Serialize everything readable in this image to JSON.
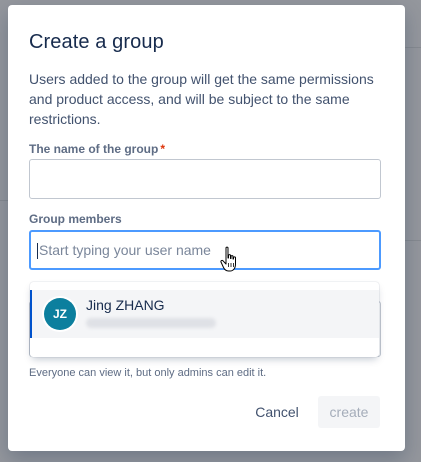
{
  "modal": {
    "title": "Create a group",
    "description": "Users added to the group will get the same permissions and product access, and will be subject to the same restrictions.",
    "group_name": {
      "label": "The name of the group",
      "required_marker": "*",
      "value": ""
    },
    "members": {
      "label": "Group members",
      "placeholder": "Start typing your user name",
      "value": ""
    },
    "visibility_hint": "Everyone can view it, but only admins can edit it.",
    "actions": {
      "cancel": "Cancel",
      "create": "create"
    }
  },
  "suggestions": [
    {
      "initials": "JZ",
      "name": "Jing ZHANG",
      "avatar_color": "#0c7f9e"
    }
  ],
  "colors": {
    "accent": "#0052cc",
    "focus_ring": "#4c9aff",
    "required": "#de350b",
    "title": "#172b4d"
  }
}
